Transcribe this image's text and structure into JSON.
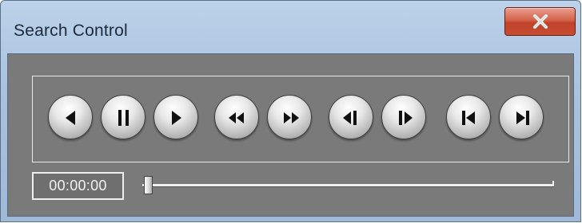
{
  "window": {
    "title": "Search Control",
    "close_label": "x"
  },
  "controls": {
    "buttons": [
      {
        "name": "previous-button",
        "icon": "previous-icon"
      },
      {
        "name": "pause-button",
        "icon": "pause-icon"
      },
      {
        "name": "play-button",
        "icon": "play-icon"
      },
      {
        "name": "rewind-button",
        "icon": "rewind-icon"
      },
      {
        "name": "fast-forward-button",
        "icon": "fast-forward-icon"
      },
      {
        "name": "step-back-button",
        "icon": "step-back-icon"
      },
      {
        "name": "step-forward-button",
        "icon": "step-forward-icon"
      },
      {
        "name": "skip-to-start-button",
        "icon": "skip-to-start-icon"
      },
      {
        "name": "skip-to-end-button",
        "icon": "skip-to-end-icon"
      }
    ]
  },
  "timecode": "00:00:00",
  "seek": {
    "position_fraction": 0.0
  },
  "colors": {
    "client_background": "#7a7a7a",
    "title_bar": "#a9c2df",
    "close_button": "#c54d33"
  }
}
